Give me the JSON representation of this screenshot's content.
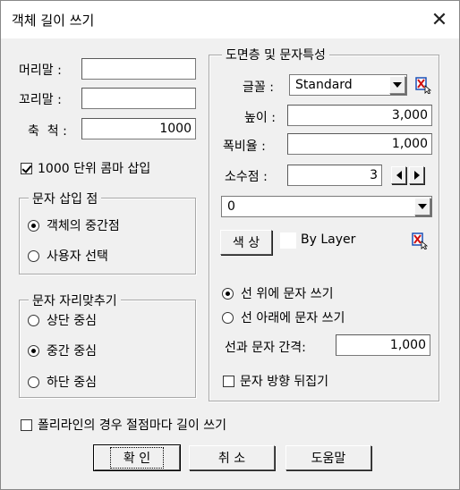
{
  "window": {
    "title": "객체 길이 쓰기",
    "close_glyph": "✕"
  },
  "left": {
    "header_label": "머리말 :",
    "header_value": "",
    "footer_label": "꼬리말 :",
    "footer_value": "",
    "scale_label": "축  척 :",
    "scale_value": "1000",
    "thousands_comma_label": "1000 단위 콤마 삽입",
    "thousands_comma_checked": true,
    "insert_point_group": {
      "legend": "문자 삽입 점",
      "options": [
        "객체의 중간점",
        "사용자 선택"
      ],
      "selected": 0
    },
    "align_group": {
      "legend": "문자 자리맞추기",
      "options": [
        "상단 중심",
        "중간 중심",
        "하단 중심"
      ],
      "selected": 1
    }
  },
  "right": {
    "legend": "도면층 및 문자특성",
    "font_label": "글꼴 :",
    "font_value": "Standard",
    "height_label": "높이 :",
    "height_value": "3,000",
    "width_ratio_label": "폭비율 :",
    "width_ratio_value": "1,000",
    "decimal_label": "소수점 :",
    "decimal_value": "3",
    "layer_value": "0",
    "color_button": "색 상",
    "by_layer_label": "By Layer",
    "text_pos_options": [
      "선 위에 문자 쓰기",
      "선 아래에 문자 쓰기"
    ],
    "text_pos_selected": 0,
    "gap_label": "선과 문자 간격:",
    "gap_value": "1,000",
    "flip_label": "문자 방향 뒤집기",
    "flip_checked": false
  },
  "polyline_label": "폴리라인의 경우 절점마다 길이 쓰기",
  "polyline_checked": false,
  "buttons": {
    "ok": "확 인",
    "cancel": "취 소",
    "help": "도움말"
  },
  "colors": {
    "title_bg": "#ffffff",
    "dialog_bg": "#f0f0f0",
    "icon_blue": "#1a4fb5",
    "icon_red": "#d01010"
  }
}
